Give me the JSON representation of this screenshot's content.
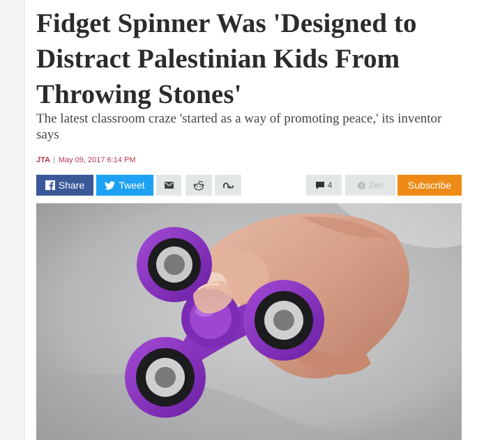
{
  "article": {
    "headline": "Fidget Spinner Was 'Designed to Distract Palestinian Kids From Throwing Stones'",
    "subtitle": "The latest classroom craze 'started as a way of promoting peace,' its inventor says",
    "byline": {
      "author": "JTA",
      "separator": "|",
      "date": "May 09, 2017 6:14 PM"
    }
  },
  "share_bar": {
    "facebook_label": "Share",
    "twitter_label": "Tweet",
    "comments_count": "4",
    "zen_label": "Zen",
    "subscribe_label": "Subscribe",
    "icons": [
      "facebook-icon",
      "twitter-icon",
      "mail-icon",
      "reddit-icon",
      "stumbleupon-icon",
      "comment-icon",
      "zen-icon"
    ]
  },
  "colors": {
    "facebook": "#3b5998",
    "twitter": "#1da1f2",
    "subscribe": "#ee8b16",
    "byline": "#b5384d",
    "spinner": "#8a2fc0"
  }
}
